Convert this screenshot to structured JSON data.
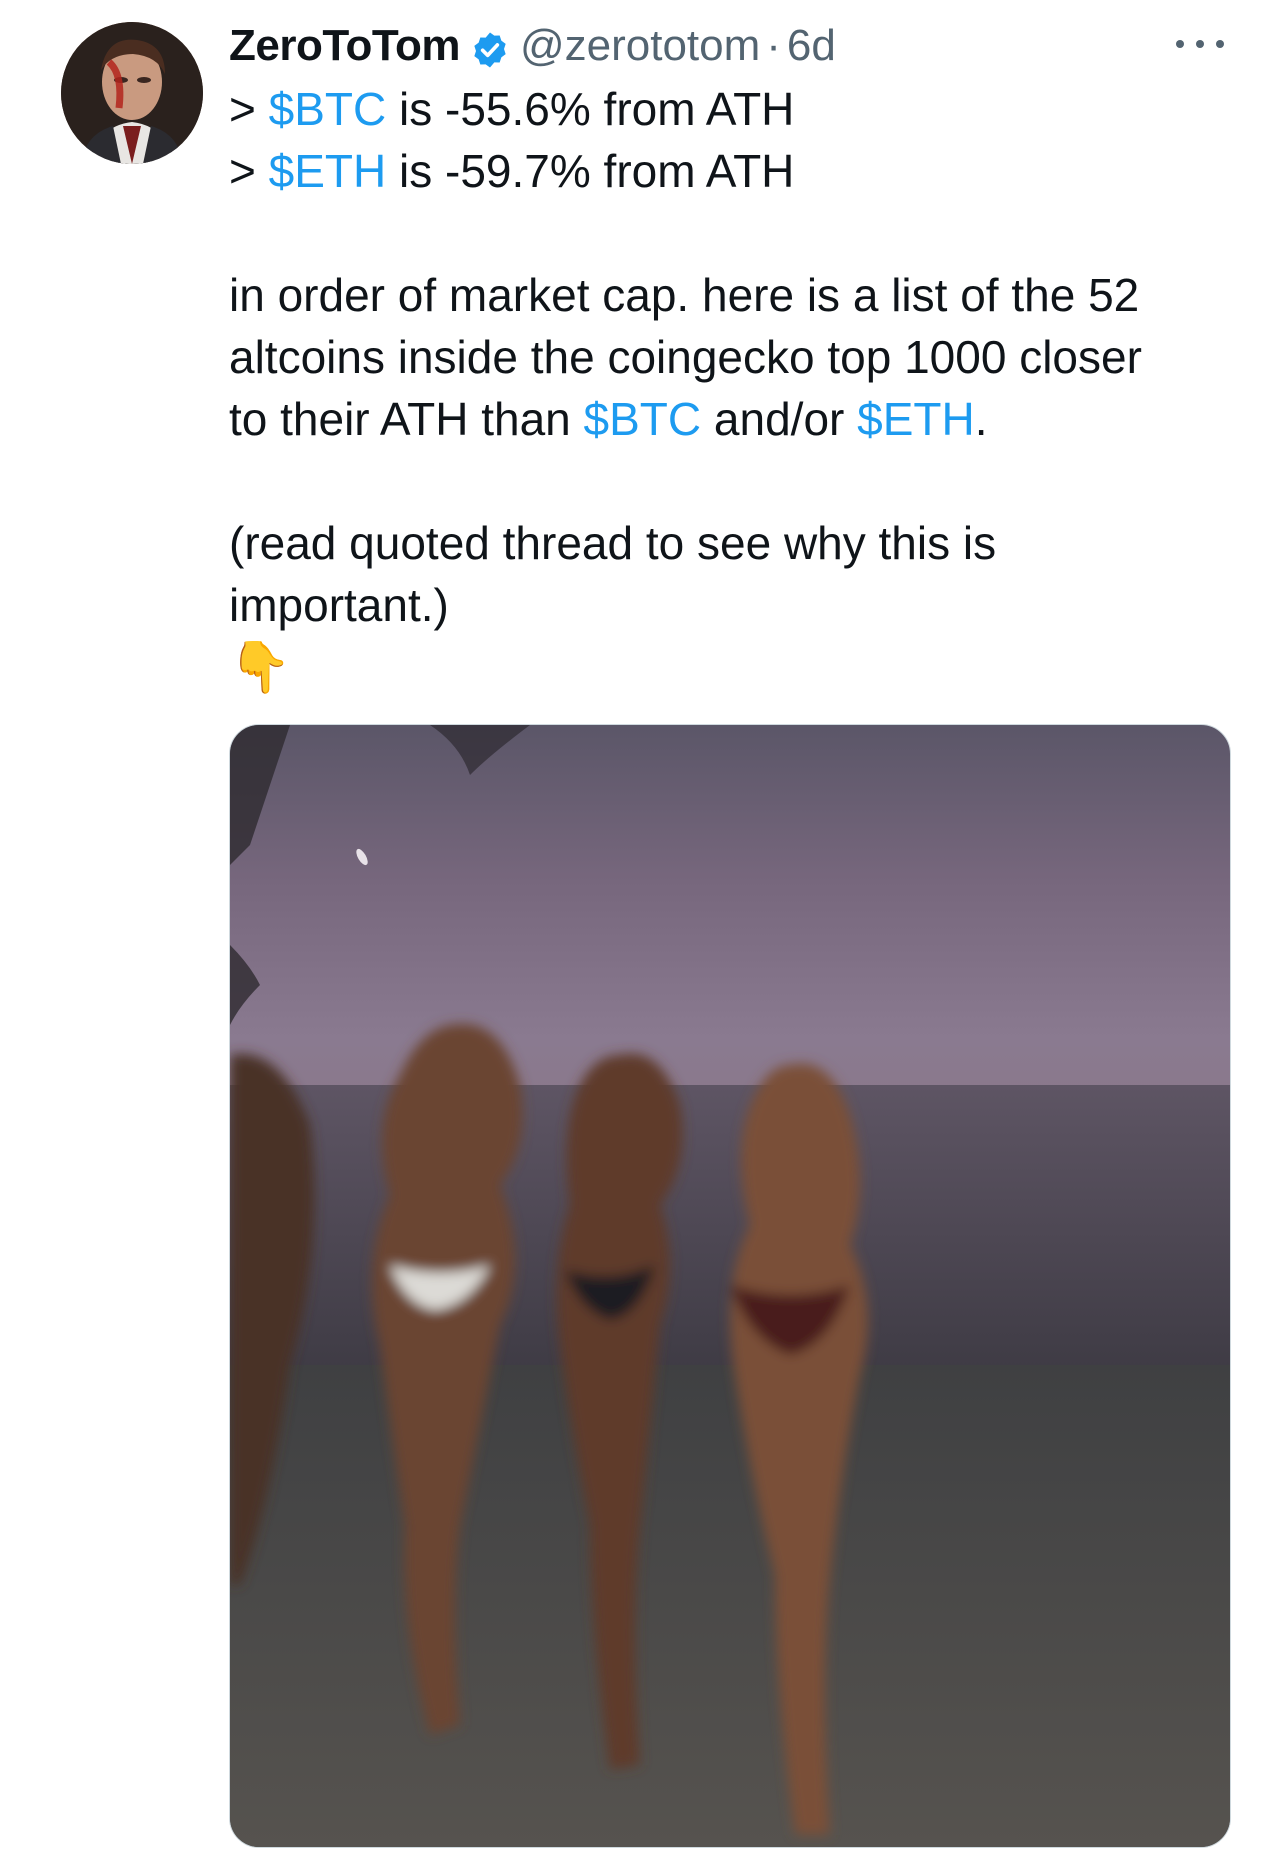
{
  "tweet": {
    "author": {
      "display_name": "ZeroToTom",
      "verified_icon": "verified-badge-icon",
      "handle": "@zerototom",
      "separator": "·",
      "timestamp": "6d"
    },
    "more_icon": "more-options-icon",
    "lines": {
      "l1_prefix": "> ",
      "l1_tag": "$BTC",
      "l1_rest": " is -55.6% from ATH",
      "l2_prefix": "> ",
      "l2_tag": "$ETH",
      "l2_rest": " is -59.7% from ATH",
      "p2_l1": "in order of market cap. here is a list of the 52",
      "p2_l2": "altcoins inside the coingecko top 1000 closer",
      "p2_l3_a": "to their ATH than ",
      "p2_l3_tag1": "$BTC",
      "p2_l3_b": " and/or ",
      "p2_l3_tag2": "$ETH",
      "p2_l3_c": ".",
      "p3_l1": "(read quoted thread to see why this is",
      "p3_l2": "important.)",
      "emoji": "👇"
    },
    "media_icon": "photo-image",
    "colors": {
      "link": "#1d9bf0",
      "text": "#0f1419",
      "secondary": "#536471"
    }
  }
}
